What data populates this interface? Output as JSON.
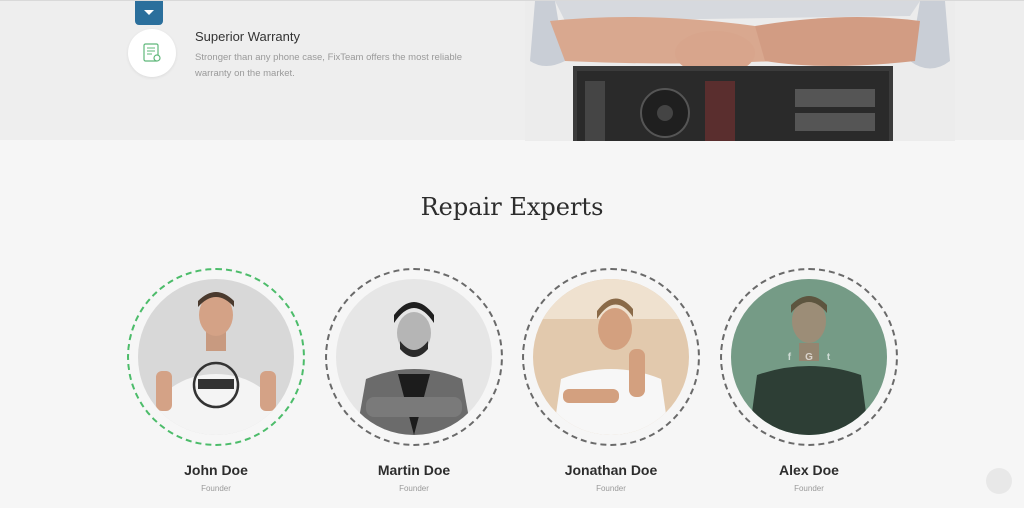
{
  "feature": {
    "icon": "certificate-icon",
    "title": "Superior Warranty",
    "text": "Stronger than any phone case, FixTeam offers the most reliable warranty on the market."
  },
  "section": {
    "title": "Repair Experts"
  },
  "experts": [
    {
      "name": "John Doe",
      "role": "Founder"
    },
    {
      "name": "Martin Doe",
      "role": "Founder"
    },
    {
      "name": "Jonathan Doe",
      "role": "Founder"
    },
    {
      "name": "Alex Doe",
      "role": "Founder",
      "social": [
        "f",
        "G",
        "t"
      ]
    }
  ],
  "colors": {
    "accent_green": "#4cbc6a",
    "tab_blue": "#2b6f9c"
  }
}
